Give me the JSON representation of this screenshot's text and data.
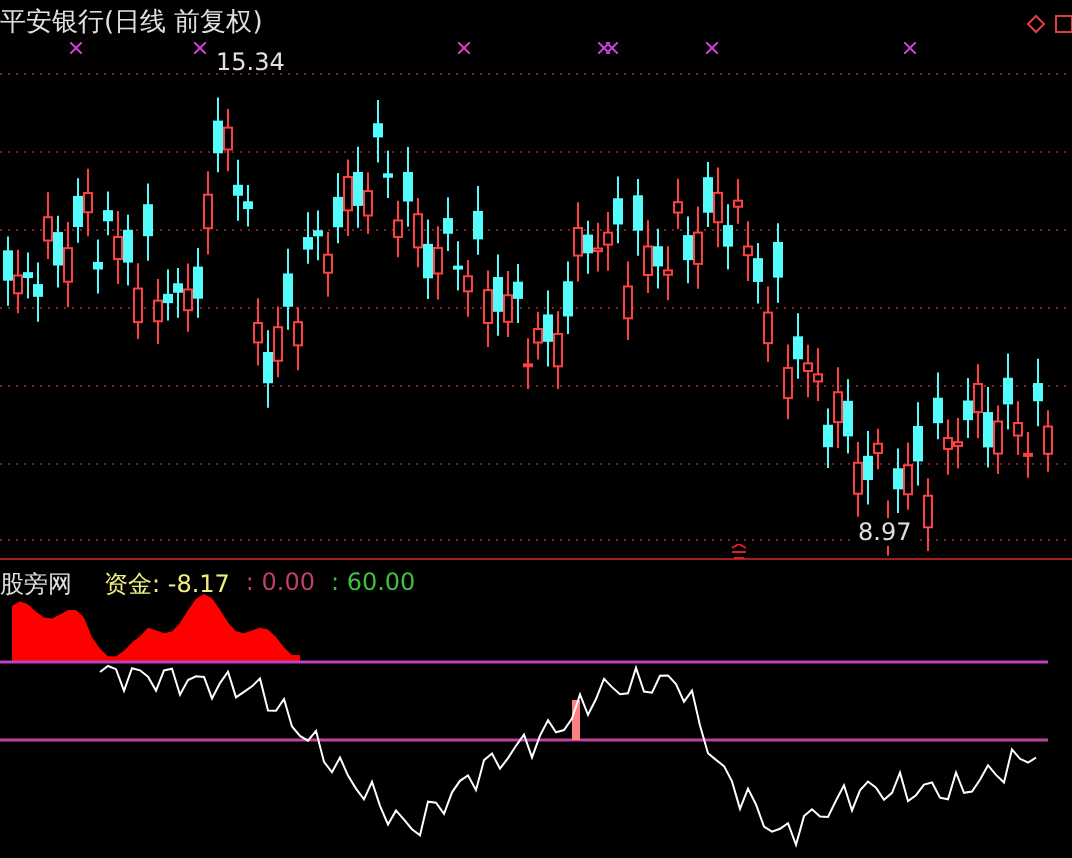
{
  "chart": {
    "title": "平安银行(日线 前复权)",
    "high_label": "15.34",
    "low_label": "8.97"
  },
  "indicator": {
    "name": "股旁网",
    "readings": [
      {
        "text": "资金: -8.17",
        "color": "#f0f080"
      },
      {
        "text": ": 0.00",
        "color": "#c0406a"
      },
      {
        "text": ": 60.00",
        "color": "#40c040"
      }
    ]
  }
}
